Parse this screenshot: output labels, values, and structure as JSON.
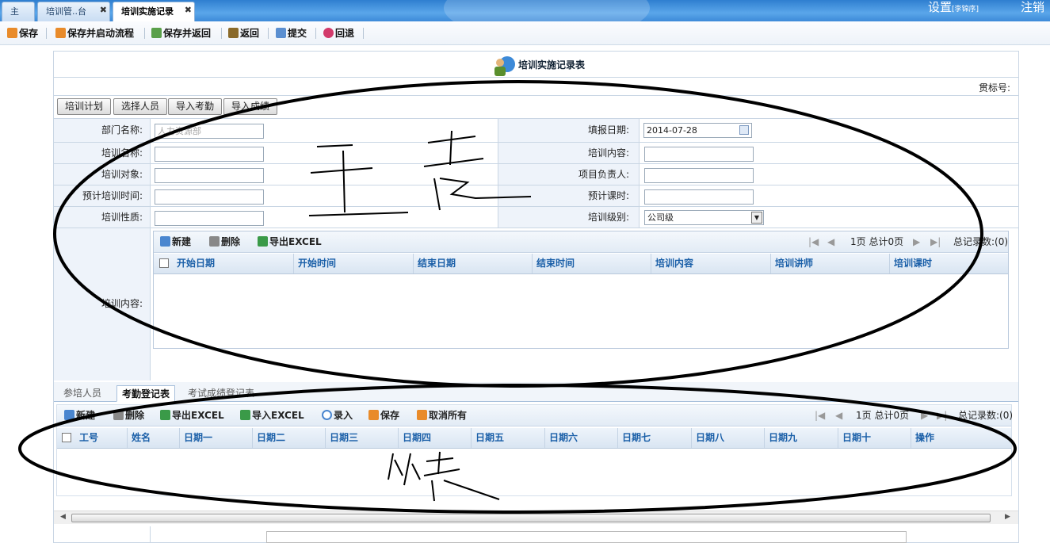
{
  "tabs": [
    {
      "label": "主页",
      "active": false,
      "closable": false
    },
    {
      "label": "培训管..台",
      "active": false,
      "closable": true
    },
    {
      "label": "培训实施记录",
      "active": true,
      "closable": true
    }
  ],
  "top_right": {
    "settings": "设置",
    "user": "[李锦序]",
    "logout": "注销"
  },
  "toolbar": [
    {
      "label": "保存",
      "icon": "save-icon"
    },
    {
      "label": "保存并启动流程",
      "icon": "save-start-icon"
    },
    {
      "label": "保存并返回",
      "icon": "save-return-icon"
    },
    {
      "label": "返回",
      "icon": "return-icon"
    },
    {
      "label": "提交",
      "icon": "submit-icon"
    },
    {
      "label": "回退",
      "icon": "rollback-icon"
    }
  ],
  "form": {
    "title": "培训实施记录表",
    "doc_no_label": "贯标号:",
    "action_buttons": [
      "培训计划",
      "选择人员",
      "导入考勤",
      "导入成绩"
    ],
    "fields_left": [
      {
        "label": "部门名称:",
        "value": "人力资源部",
        "placeholder": true
      },
      {
        "label": "培训名称:",
        "value": ""
      },
      {
        "label": "培训对象:",
        "value": ""
      },
      {
        "label": "预计培训时间:",
        "value": ""
      },
      {
        "label": "培训性质:",
        "value": ""
      }
    ],
    "fields_right": [
      {
        "label": "填报日期:",
        "value": "2014-07-28",
        "type": "date"
      },
      {
        "label": "培训内容:",
        "value": ""
      },
      {
        "label": "项目负责人:",
        "value": ""
      },
      {
        "label": "预计课时:",
        "value": ""
      },
      {
        "label": "培训级别:",
        "value": "公司级",
        "type": "select"
      }
    ],
    "content_label": "培训内容:"
  },
  "content_grid": {
    "tools": [
      "新建",
      "删除",
      "导出EXCEL"
    ],
    "pager": "1页 总计0页",
    "total": "总记录数:(0)",
    "columns": [
      "开始日期",
      "开始时间",
      "结束日期",
      "结束时间",
      "培训内容",
      "培训讲师",
      "培训课时"
    ]
  },
  "sub_tabs": [
    {
      "label": "参培人员",
      "active": false
    },
    {
      "label": "考勤登记表",
      "active": true
    },
    {
      "label": "考试成绩登记表",
      "active": false
    }
  ],
  "attendance_grid": {
    "tools": [
      "新建",
      "删除",
      "导出EXCEL",
      "导入EXCEL",
      "录入",
      "保存",
      "取消所有"
    ],
    "pager": "1页 总计0页",
    "total": "总记录数:(0)",
    "columns": [
      "工号",
      "姓名",
      "日期一",
      "日期二",
      "日期三",
      "日期四",
      "日期五",
      "日期六",
      "日期七",
      "日期八",
      "日期九",
      "日期十",
      "操作"
    ]
  },
  "annotations": {
    "main": "主表",
    "detail": "从表"
  },
  "colors": {
    "accent": "#2f7fd0",
    "header_text": "#1a5fa8",
    "label_bg": "#eef3fa"
  }
}
